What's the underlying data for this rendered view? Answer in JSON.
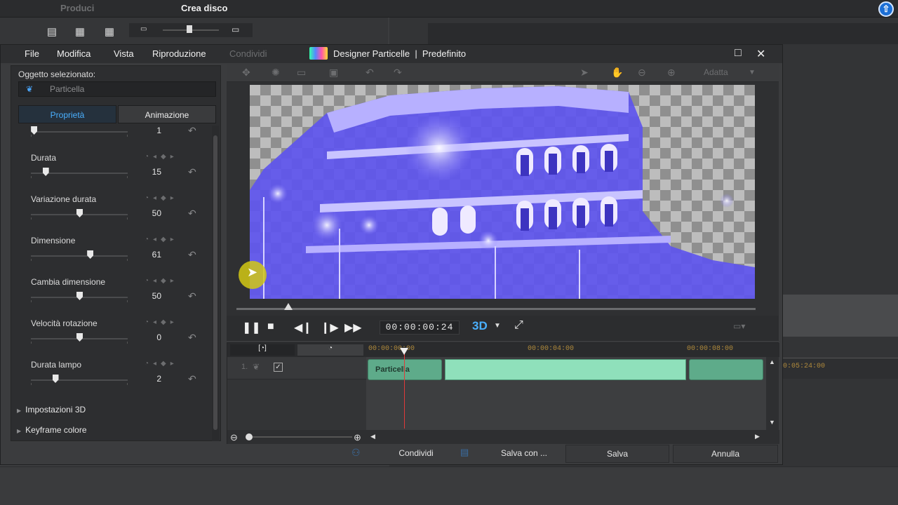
{
  "back_app": {
    "tabs": [
      "Produci",
      "Crea disco"
    ]
  },
  "dialog": {
    "title": "Designer Particelle  |  Predefinito",
    "menu": [
      "File",
      "Modifica",
      "Vista",
      "Riproduzione",
      "Condividi"
    ],
    "window_buttons": {
      "maximize": "□",
      "close": "✕"
    }
  },
  "left_panel": {
    "selected_label": "Oggetto selezionato:",
    "selected_value": "Particella",
    "tabs": [
      "Proprietà",
      "Animazione"
    ],
    "properties": [
      {
        "label": "",
        "value": "1",
        "level": 0.03
      },
      {
        "label": "Durata",
        "value": "15",
        "level": 0.15
      },
      {
        "label": "Variazione durata",
        "value": "50",
        "level": 0.5
      },
      {
        "label": "Dimensione",
        "value": "61",
        "level": 0.61
      },
      {
        "label": "Cambia dimensione",
        "value": "50",
        "level": 0.5
      },
      {
        "label": "Velocità rotazione",
        "value": "0",
        "level": 0.5
      },
      {
        "label": "Durata lampo",
        "value": "2",
        "level": 0.25
      }
    ],
    "sections": [
      "Impostazioni 3D",
      "Keyframe colore"
    ]
  },
  "preview": {
    "zoom_label": "Adatta",
    "timecode": "00:00:00:24",
    "mode_3d": "3D",
    "progress": 0.1
  },
  "timeline": {
    "ruler": [
      "00:00:00:00",
      "00:00:04:00",
      "00:00:08:00"
    ],
    "back_ruler": [
      "0:05:24:00"
    ],
    "track_number": "1.",
    "clip_label": "Particella"
  },
  "footer": {
    "share": "Condividi",
    "save_as": "Salva con ...",
    "save": "Salva",
    "cancel": "Annulla"
  },
  "colors": {
    "accent": "#4ab0ff",
    "clip": "#8fe0bb",
    "playhead": "#e03a3a",
    "particle": "#5b4fff"
  }
}
